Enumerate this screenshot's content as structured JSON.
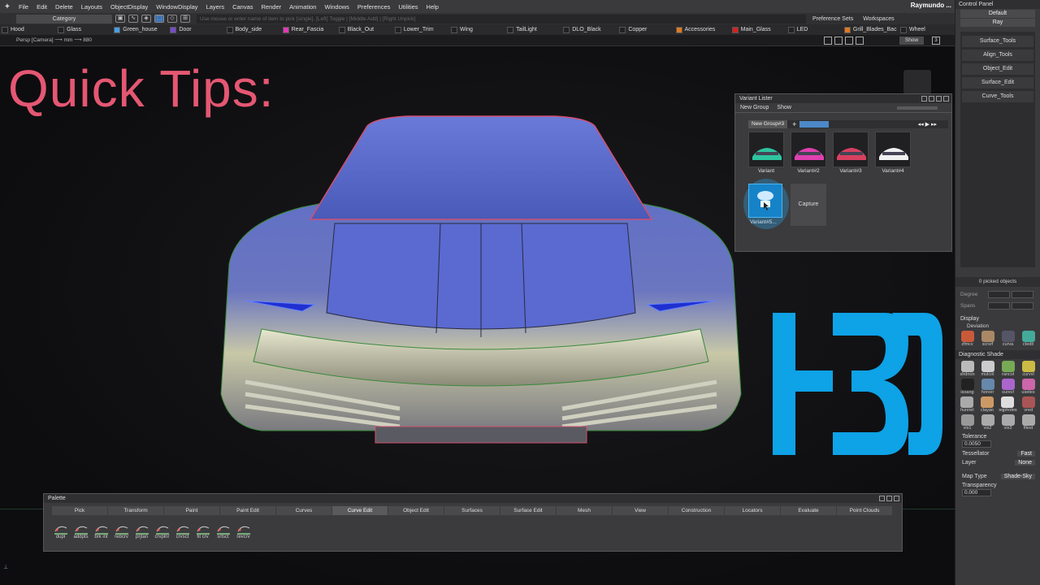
{
  "menubar": {
    "items": [
      "File",
      "Edit",
      "Delete",
      "Layouts",
      "ObjectDisplay",
      "WindowDisplay",
      "Layers",
      "Canvas",
      "Render",
      "Animation",
      "Windows",
      "Preferences",
      "Utilities",
      "Help"
    ],
    "user": "Raymundo ..."
  },
  "toolbar": {
    "category": "Category",
    "hint": "Use mouse or enter name of item to pick [single]. [Left] Toggle | [Middle Add] | [Right Unpick]",
    "preference_sets": "Preference Sets",
    "workspaces": "Workspaces"
  },
  "layers": [
    {
      "name": "Hood",
      "color": "#222222"
    },
    {
      "name": "Glass",
      "color": "#222222"
    },
    {
      "name": "Green_house",
      "color": "#4a9ee0"
    },
    {
      "name": "Door",
      "color": "#7a4cc8"
    },
    {
      "name": "Body_side",
      "color": "#222222"
    },
    {
      "name": "Rear_Fascia",
      "color": "#e03ab4"
    },
    {
      "name": "Black_Out",
      "color": "#222222"
    },
    {
      "name": "Lower_Trim",
      "color": "#222222"
    },
    {
      "name": "Wing",
      "color": "#222222"
    },
    {
      "name": "TailLight",
      "color": "#222222"
    },
    {
      "name": "DLO_Black",
      "color": "#222222"
    },
    {
      "name": "Copper",
      "color": "#222222"
    },
    {
      "name": "Accessories",
      "color": "#e07820"
    },
    {
      "name": "Main_Glass",
      "color": "#d82020"
    },
    {
      "name": "LED",
      "color": "#222222"
    },
    {
      "name": "Grill_Blades_Bac",
      "color": "#e07820"
    },
    {
      "name": "Wheel",
      "color": "#222222"
    }
  ],
  "viewport": {
    "camera_label": "Persp [Camera] ⟶ mm ⟶ 880",
    "show_button": "Show",
    "page_num": "3"
  },
  "overlay": {
    "quick_tips": "Quick Tips:",
    "variant_lister": "Variant Lister"
  },
  "variant_lister": {
    "title": "Variant Lister",
    "tabs": [
      "New Group",
      "Show"
    ],
    "group_name": "New Group#3",
    "thumbnails": [
      {
        "label": "Variant",
        "accent": "#2ec4a0"
      },
      {
        "label": "Variant#2",
        "accent": "#e040b0"
      },
      {
        "label": "Variant#3",
        "accent": "#d84060"
      },
      {
        "label": "Variant#4",
        "accent": "#f0f0f0"
      }
    ],
    "selected_label": "Variant#5...",
    "capture_label": "Capture"
  },
  "palette": {
    "title": "Palette",
    "tabs": [
      "Pick",
      "Transform",
      "Paint",
      "Paint Edit",
      "Curves",
      "Curve Edit",
      "Object Edit",
      "Surfaces",
      "Surface Edit",
      "Mesh",
      "View",
      "Construction",
      "Locators",
      "Evaluate",
      "Point Clouds"
    ],
    "active_tab": "Curve Edit",
    "tools": [
      "dupl",
      "addpts",
      "brk int",
      "rebcrv",
      "prjtan",
      "crvplnr",
      "crvsct",
      "fit crv",
      "srtsct",
      "revcrv"
    ]
  },
  "control_panel": {
    "title": "Control Panel",
    "preset": "Default",
    "render": "Ray",
    "shelf_items": [
      "Surface_Tools",
      "Align_Tools",
      "Object_Edit",
      "Surface_Edit",
      "Curve_Tools"
    ],
    "picked": "0 picked objects",
    "degree_label": "Degree",
    "spans_label": "Spans",
    "display_label": "Display",
    "deviation_label": "Deviation",
    "display_tools": [
      "zfmcv",
      "scrsrf",
      "curva",
      "ctedit"
    ],
    "diagnostic_title": "Diagnostic Shade",
    "diagnostic_tools": [
      [
        "shdnon",
        "mulcol",
        "rancol",
        "curvvl"
      ],
      [
        "isoang",
        "horver",
        "surevl",
        "usetes"
      ],
      [
        "hunnel",
        "clayao",
        "sqphotes",
        "vred"
      ],
      [
        "vis1",
        "vis2",
        "vis3",
        "filest"
      ]
    ],
    "tolerance_label": "Tolerance",
    "tolerance_value": "0.0050",
    "tessellator_label": "Tessellator",
    "tessellator_value": "Fast",
    "layer_label": "Layer",
    "layer_value": "None",
    "map_type_label": "Map Type",
    "map_type_value": "Shade-Sky",
    "transparency_label": "Transparency",
    "transparency_value": "0.000"
  }
}
